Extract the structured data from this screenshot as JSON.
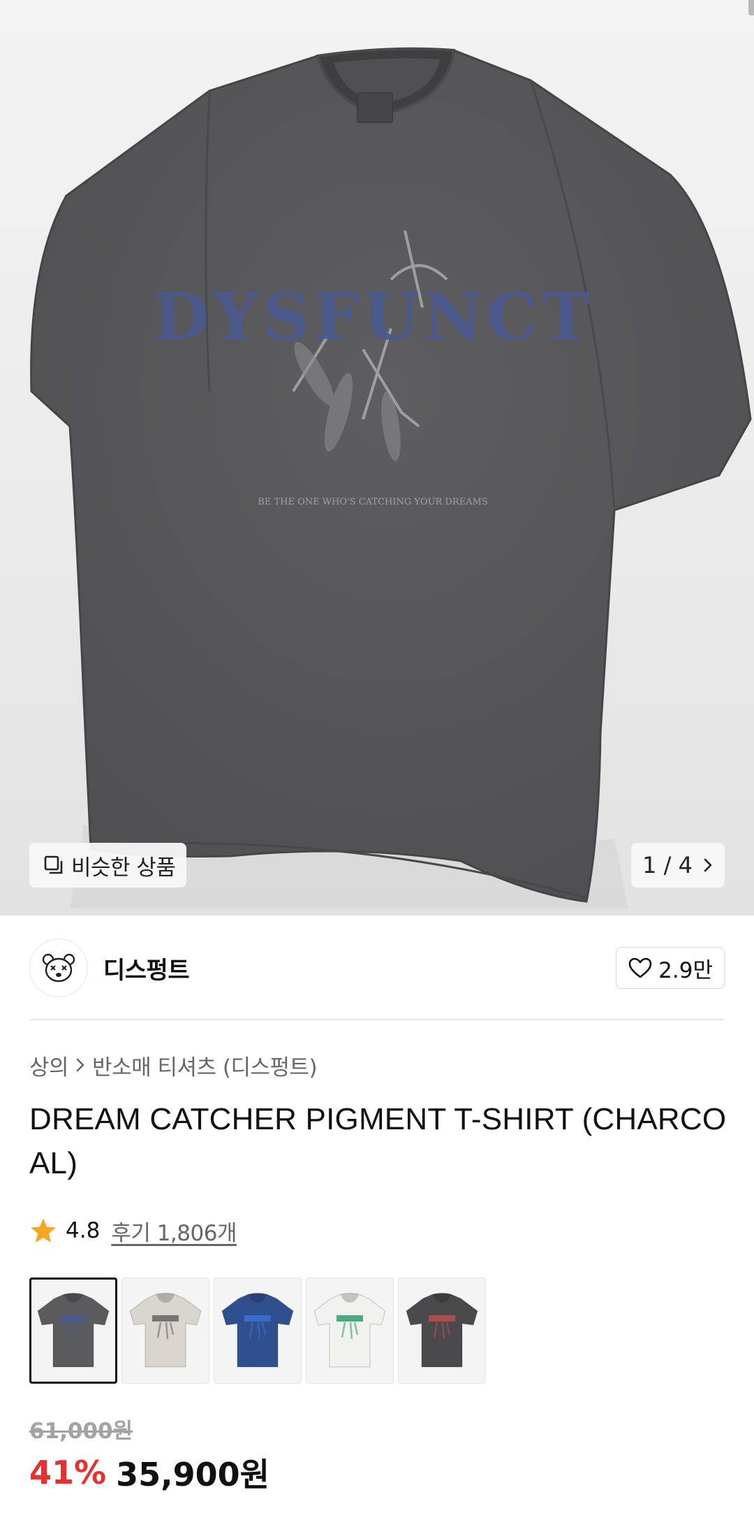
{
  "colors": {
    "accent_discount": "#e8312f",
    "star": "#f5a623",
    "shirt": "#5a5a5d",
    "print_blue": "#4a5a8f"
  },
  "hero": {
    "similar_button": {
      "icon": "similar-items-icon",
      "label": "비슷한 상품"
    },
    "pager": {
      "text": "1 / 4",
      "icon": "chevron-right-icon"
    },
    "print_logo_text": "DYSFUNCT",
    "print_slogan_text": "BE THE ONE WHO'S CATCHING YOUR DREAMS"
  },
  "brand": {
    "name": "디스펑트",
    "logo_icon": "bear-logo-icon",
    "like_icon": "heart-icon",
    "like_count": "2.9만"
  },
  "breadcrumb": {
    "category": "상의",
    "separator_icon": "chevron-right-icon",
    "subcategory": "반소매 티셔츠 (디스펑트)"
  },
  "product": {
    "title": "DREAM CATCHER PIGMENT T-SHIRT (CHARCOAL)",
    "rating_icon": "star-icon",
    "rating": "4.8",
    "reviews_label": "후기 1,806개"
  },
  "color_options": [
    {
      "name": "charcoal",
      "color": "#5b5b5e",
      "print": "#4a5a8f",
      "selected": true
    },
    {
      "name": "beige",
      "color": "#d9d4ce",
      "print": "#6b6b6b",
      "selected": false
    },
    {
      "name": "navy",
      "color": "#2f4f8f",
      "print": "#3b6fd0",
      "selected": false
    },
    {
      "name": "white",
      "color": "#f1f1ef",
      "print": "#3fa070",
      "selected": false
    },
    {
      "name": "dark-gray",
      "color": "#4a4a4c",
      "print": "#b05050",
      "selected": false
    }
  ],
  "price": {
    "original": "61,000원",
    "discount": "41%",
    "sale": "35,900원"
  }
}
